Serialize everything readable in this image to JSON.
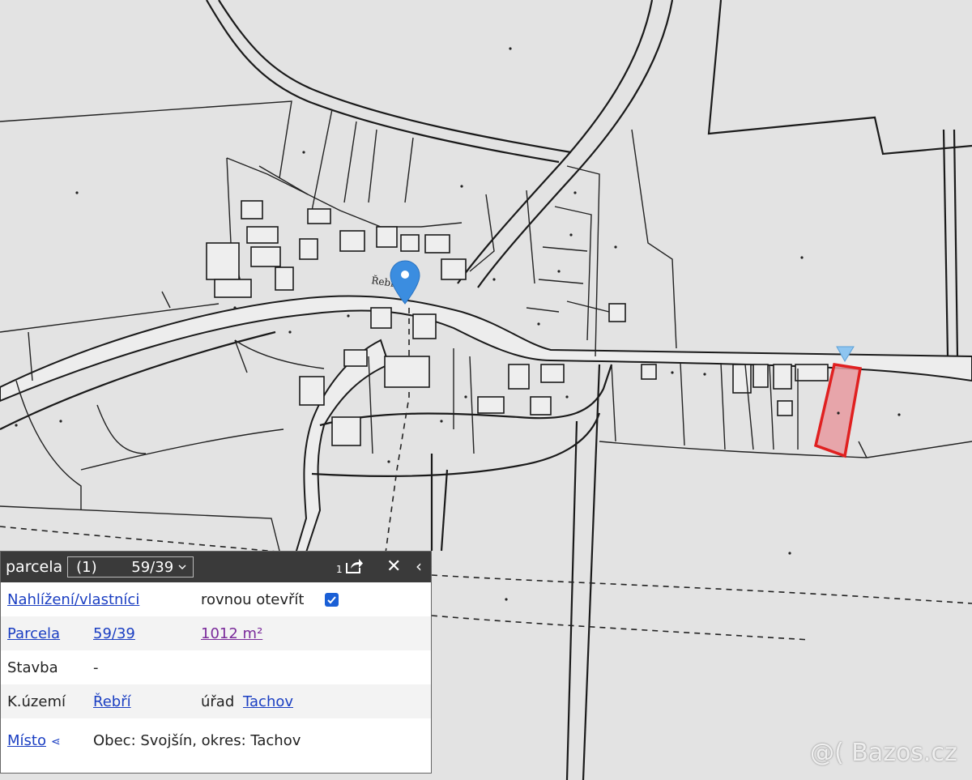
{
  "map": {
    "street_label": "Řebří",
    "marker_color": "#3b8de0",
    "highlight_color": "#e02020",
    "highlight_fill": "#e89aa0",
    "pin_icon": "map-pin-icon"
  },
  "panel": {
    "title": "parcela",
    "selector": {
      "count": "(1)",
      "value": "59/39"
    },
    "share_count": "1",
    "rows": {
      "nahlizeni": {
        "link": "Nahlížení/vlastníci",
        "option": "rovnou otevřít",
        "checked": true
      },
      "parcela": {
        "label": "Parcela",
        "number": "59/39",
        "area": "1012 m²"
      },
      "stavba": {
        "label": "Stavba",
        "value": "-"
      },
      "uzemi": {
        "label": "K.území",
        "value": "Řebří",
        "office_label": "úřad",
        "office": "Tachov"
      },
      "misto": {
        "label": "Místo",
        "value": "Obec: Svojšín, okres: Tachov"
      }
    }
  },
  "watermark": "@( Bazos.cz"
}
